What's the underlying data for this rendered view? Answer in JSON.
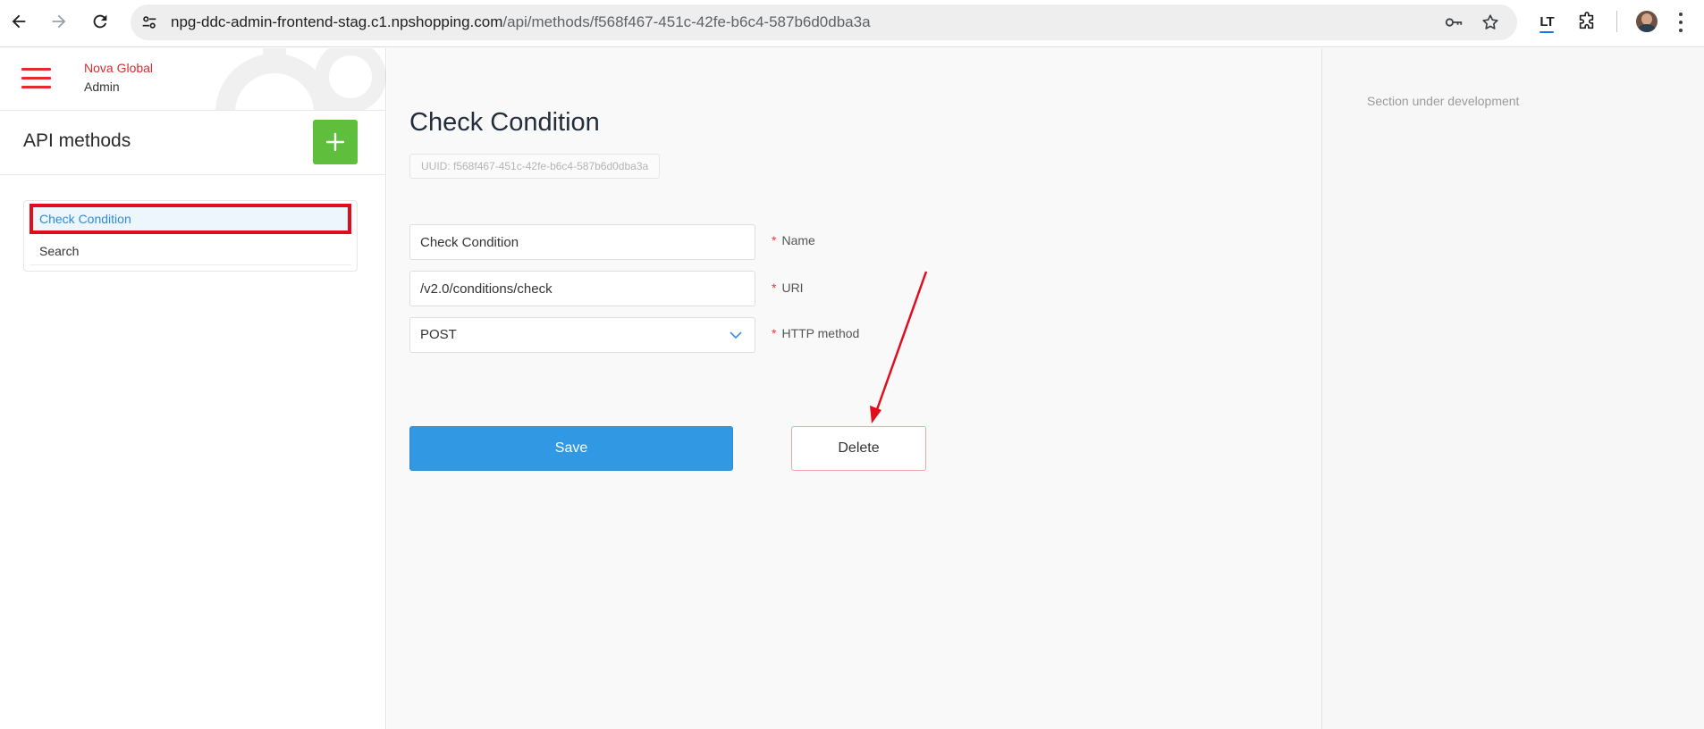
{
  "browser": {
    "url_host": "npg-ddc-admin-frontend-stag.c1.npshopping.com",
    "url_path": "/api/methods/f568f467-451c-42fe-b6c4-587b6d0dba3a",
    "icons": [
      "back-icon",
      "forward-icon",
      "reload-icon",
      "site-settings-icon",
      "password-key-icon",
      "bookmark-star-icon",
      "lt-extension-icon",
      "extensions-puzzle-icon",
      "profile-avatar",
      "menu-kebab-icon"
    ]
  },
  "sidebar": {
    "brand_line1": "Nova Global",
    "brand_line2": "Admin",
    "title": "API methods",
    "add_icon": "plus-icon",
    "items": [
      {
        "label": "Check Condition",
        "active": true
      },
      {
        "label": "Search",
        "active": false
      }
    ]
  },
  "main": {
    "title": "Check Condition",
    "uuid": "UUID: f568f467-451c-42fe-b6c4-587b6d0dba3a",
    "fields": {
      "name": {
        "value": "Check Condition",
        "label": "Name"
      },
      "uri": {
        "value": "/v2.0/conditions/check",
        "label": "URI"
      },
      "http_method": {
        "value": "POST",
        "label": "HTTP method"
      }
    },
    "required_mark": "*",
    "save_label": "Save",
    "delete_label": "Delete"
  },
  "right_panel": {
    "note": "Section under development"
  },
  "colors": {
    "accent_blue": "#3199e4",
    "add_green": "#5fbe3c",
    "brand_red": "#d32f2f",
    "highlight_red": "#e00e1c"
  }
}
